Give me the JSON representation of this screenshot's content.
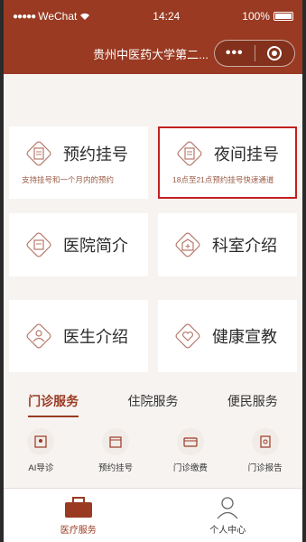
{
  "status": {
    "carrier": "WeChat",
    "time": "14:24",
    "battery": "100%"
  },
  "nav": {
    "title": "贵州中医药大学第二...",
    "more": "•••"
  },
  "tiles": [
    {
      "label": "预约挂号",
      "sub": "支持挂号和一个月内的预约",
      "icon": "clipboard-icon"
    },
    {
      "label": "夜间挂号",
      "sub": "18点至21点预约挂号快速通道",
      "icon": "clipboard-icon"
    },
    {
      "label": "医院简介",
      "icon": "document-icon"
    },
    {
      "label": "科室介绍",
      "icon": "clinic-icon"
    },
    {
      "label": "医生介绍",
      "icon": "doctor-icon"
    },
    {
      "label": "健康宣教",
      "icon": "heart-hands-icon"
    }
  ],
  "tabs": [
    {
      "label": "门诊服务",
      "active": true
    },
    {
      "label": "住院服务",
      "active": false
    },
    {
      "label": "便民服务",
      "active": false
    }
  ],
  "services": [
    {
      "label": "AI导诊",
      "icon": "ai-guide-icon"
    },
    {
      "label": "预约挂号",
      "icon": "calendar-icon"
    },
    {
      "label": "门诊缴费",
      "icon": "payment-icon"
    },
    {
      "label": "门诊报告",
      "icon": "report-icon"
    }
  ],
  "tabbar": [
    {
      "label": "医疗服务",
      "active": true,
      "icon": "medical-service-icon"
    },
    {
      "label": "个人中心",
      "active": false,
      "icon": "person-icon"
    }
  ],
  "colors": {
    "brand": "#9a3a22",
    "highlight": "#c22020"
  }
}
